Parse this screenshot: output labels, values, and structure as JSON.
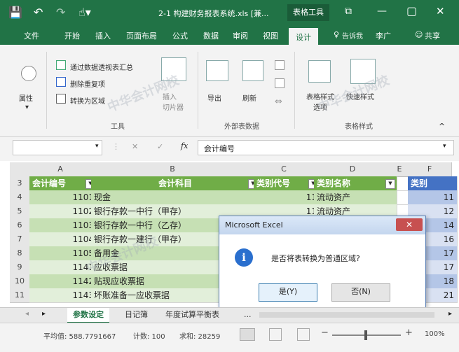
{
  "titlebar": {
    "save_icon": "save-icon",
    "undo_icon": "undo-icon",
    "redo_icon": "redo-icon",
    "touch_icon": "touch-mode-icon",
    "doc_title": "2-1 构建财务报表系统.xls [兼...",
    "context_tab": "表格工具",
    "minimize": "—",
    "restore": "▢",
    "close": "✕"
  },
  "menu": {
    "items": [
      "文件",
      "开始",
      "插入",
      "页面布局",
      "公式",
      "数据",
      "审阅",
      "视图",
      "设计"
    ],
    "tell_me": "告诉我",
    "user": "李广",
    "share": "共享"
  },
  "ribbon": {
    "properties": "属性",
    "tools": {
      "summarize_pivot": "通过数据透视表汇总",
      "remove_duplicates": "删除重复项",
      "convert_to_range": "转换为区域",
      "insert_slicer": "插入\n切片器",
      "group_label": "工具"
    },
    "external": {
      "export": "导出",
      "refresh": "刷新",
      "group_label": "外部表数据"
    },
    "styles": {
      "style_options": "表格样式\n选项",
      "quick_styles": "快速样式",
      "group_label": "表格样式"
    }
  },
  "formula_bar": {
    "name_box": "",
    "cancel": "✕",
    "enter": "✓",
    "fx": "fx",
    "content": "会计编号"
  },
  "grid": {
    "columns": [
      "A",
      "B",
      "C",
      "D",
      "E",
      "F"
    ],
    "header_row": {
      "num": "3",
      "cells": [
        "会计编号",
        "会计科目",
        "类别代号",
        "类别名称",
        "",
        "类别"
      ]
    },
    "rows": [
      {
        "num": "4",
        "code": "1101",
        "subject": "现金",
        "cat_code": "11",
        "cat_name": "流动资产",
        "f": "11"
      },
      {
        "num": "5",
        "code": "1102",
        "subject": "银行存款一中行（甲存）",
        "cat_code": "11",
        "cat_name": "流动资产",
        "f": "12"
      },
      {
        "num": "6",
        "code": "1103",
        "subject": "银行存款一中行（乙存）",
        "cat_code": "",
        "cat_name": "",
        "f": "14"
      },
      {
        "num": "7",
        "code": "1104",
        "subject": "银行存款一建行（甲存）",
        "cat_code": "",
        "cat_name": "",
        "f": "16"
      },
      {
        "num": "8",
        "code": "1105",
        "subject": "备用金",
        "cat_code": "",
        "cat_name": "",
        "f": "17"
      },
      {
        "num": "9",
        "code": "1141",
        "subject": "应收票据",
        "cat_code": "",
        "cat_name": "",
        "f": "17"
      },
      {
        "num": "10",
        "code": "1142",
        "subject": "贴现应收票据",
        "cat_code": "",
        "cat_name": "",
        "f": "18"
      },
      {
        "num": "11",
        "code": "1143",
        "subject": "坏账准备一应收票据",
        "cat_code": "",
        "cat_name": "",
        "f": "21"
      }
    ]
  },
  "dialog": {
    "title": "Microsoft Excel",
    "message": "是否将表转换为普通区域?",
    "yes": "是(Y)",
    "no": "否(N)",
    "close": "✕"
  },
  "sheets": {
    "tabs": [
      "参数设定",
      "日记簿",
      "年度试算平衡表"
    ],
    "active": "参数设定",
    "more": "..."
  },
  "status": {
    "average": "平均值: 588.7791667",
    "count": "计数: 100",
    "sum": "求和: 28259",
    "zoom": "100%",
    "zoom_minus": "−",
    "zoom_plus": "+"
  },
  "colors": {
    "excel_green": "#217346",
    "table_header": "#70ad47",
    "band1": "#c6e0b4",
    "band2": "#e2efda"
  }
}
